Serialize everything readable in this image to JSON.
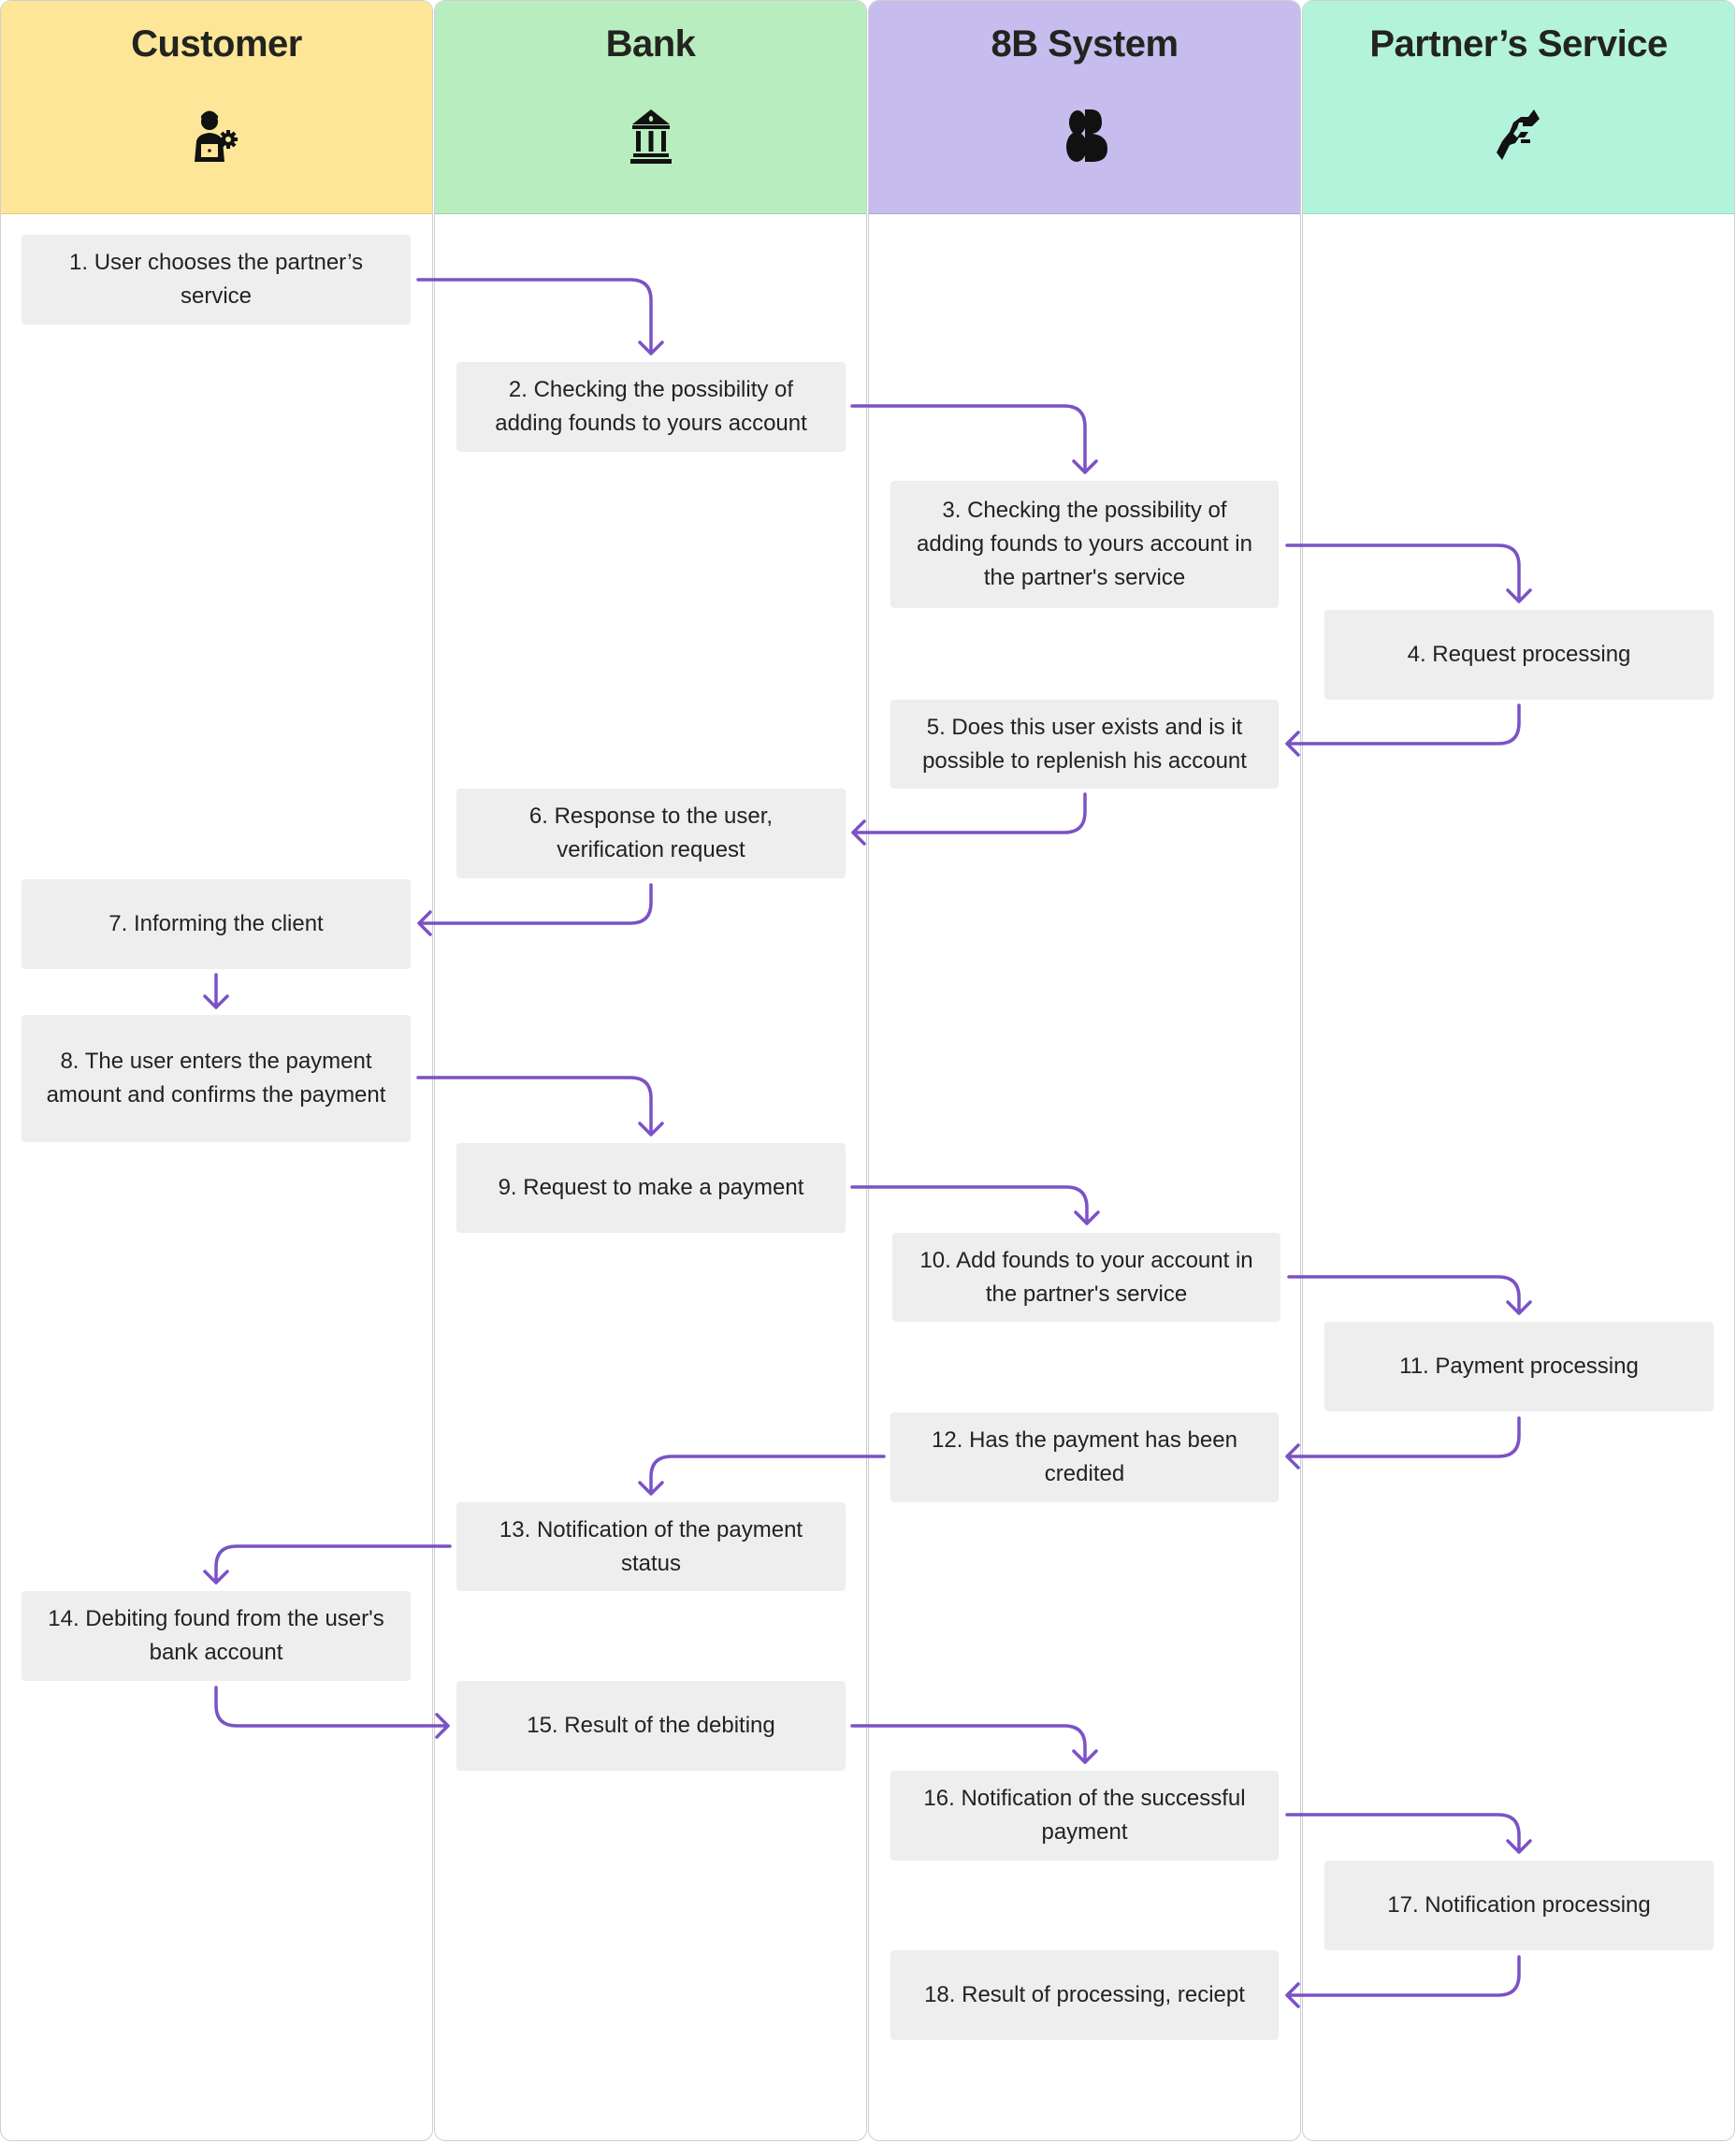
{
  "lanes": [
    {
      "id": "customer",
      "title": "Customer",
      "icon": "user-laptop-gear-icon",
      "color": "#fee698"
    },
    {
      "id": "bank",
      "title": "Bank",
      "icon": "bank-building-icon",
      "color": "#b8edbf"
    },
    {
      "id": "system",
      "title": "8B System",
      "icon": "8b-logo-icon",
      "color": "#c6bdee"
    },
    {
      "id": "partner",
      "title": "Partner’s Service",
      "icon": "handshake-hands-icon",
      "color": "#b3f3dc"
    }
  ],
  "arrow_color": "#7b52c6",
  "steps": [
    {
      "n": 1,
      "lane": 0,
      "text": "1. User chooses the partner’s service"
    },
    {
      "n": 2,
      "lane": 1,
      "text": "2. Checking the possibility of adding founds to yours account"
    },
    {
      "n": 3,
      "lane": 2,
      "text": "3. Checking the possibility of adding founds to yours account in the partner's service"
    },
    {
      "n": 4,
      "lane": 3,
      "text": "4. Request processing"
    },
    {
      "n": 5,
      "lane": 2,
      "text": "5. Does this user exists and is it possible to replenish his account"
    },
    {
      "n": 6,
      "lane": 1,
      "text": "6. Response to the user, verification request"
    },
    {
      "n": 7,
      "lane": 0,
      "text": "7. Informing the client"
    },
    {
      "n": 8,
      "lane": 0,
      "text": "8. The user enters the payment amount and confirms the payment"
    },
    {
      "n": 9,
      "lane": 1,
      "text": "9. Request to make a payment"
    },
    {
      "n": 10,
      "lane": 2,
      "text": "10. Add founds to your account in the partner's service"
    },
    {
      "n": 11,
      "lane": 3,
      "text": "11. Payment processing"
    },
    {
      "n": 12,
      "lane": 2,
      "text": "12. Has the payment has been credited"
    },
    {
      "n": 13,
      "lane": 1,
      "text": "13. Notification of the payment status"
    },
    {
      "n": 14,
      "lane": 0,
      "text": "14. Debiting found from the user's bank account"
    },
    {
      "n": 15,
      "lane": 1,
      "text": "15. Result of the debiting"
    },
    {
      "n": 16,
      "lane": 2,
      "text": "16. Notification of the successful payment"
    },
    {
      "n": 17,
      "lane": 3,
      "text": "17. Notification processing"
    },
    {
      "n": 18,
      "lane": 2,
      "text": "18. Result of processing, reciept"
    }
  ],
  "flows": [
    {
      "from": 1,
      "to": 2
    },
    {
      "from": 2,
      "to": 3
    },
    {
      "from": 3,
      "to": 4
    },
    {
      "from": 4,
      "to": 5
    },
    {
      "from": 5,
      "to": 6
    },
    {
      "from": 6,
      "to": 7
    },
    {
      "from": 7,
      "to": 8
    },
    {
      "from": 8,
      "to": 9
    },
    {
      "from": 9,
      "to": 10
    },
    {
      "from": 10,
      "to": 11
    },
    {
      "from": 11,
      "to": 12
    },
    {
      "from": 12,
      "to": 13
    },
    {
      "from": 13,
      "to": 14
    },
    {
      "from": 14,
      "to": 15
    },
    {
      "from": 15,
      "to": 16
    },
    {
      "from": 16,
      "to": 17
    },
    {
      "from": 17,
      "to": 18
    }
  ]
}
